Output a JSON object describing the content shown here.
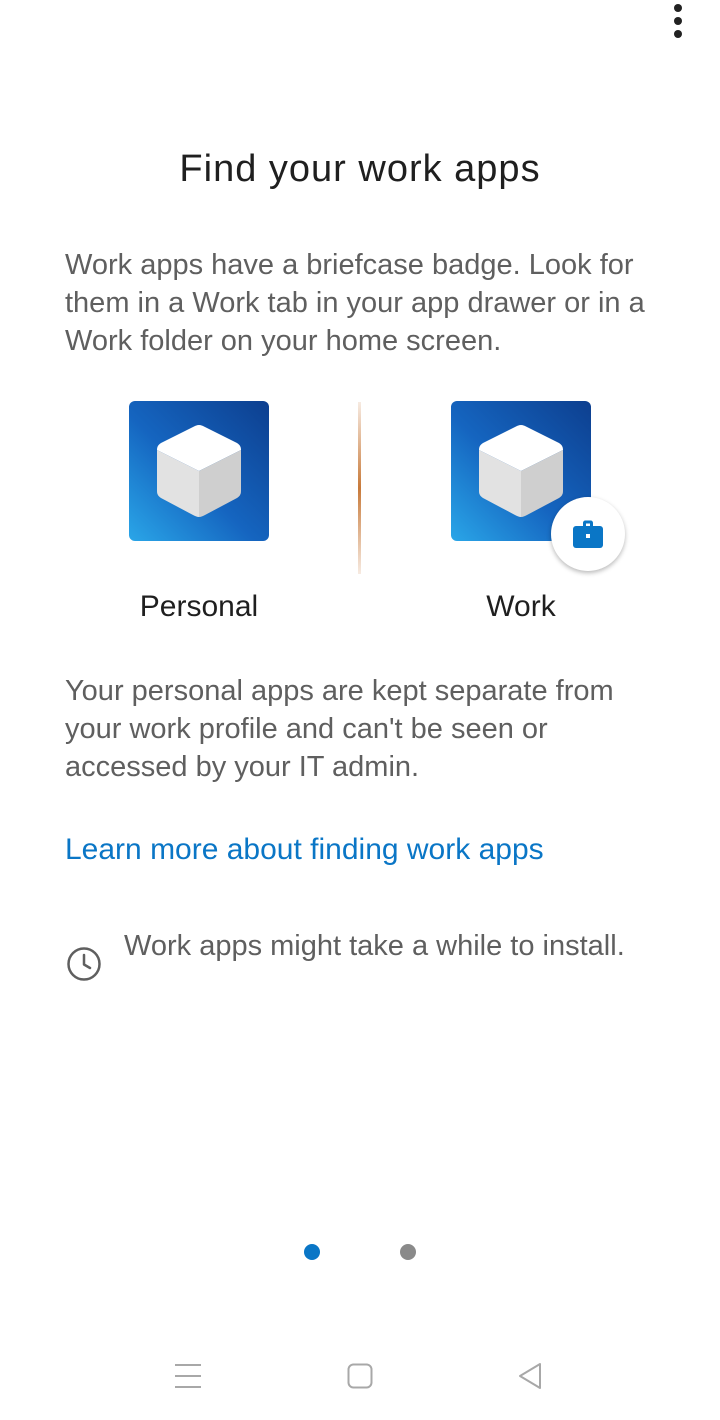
{
  "title": "Find your work apps",
  "intro": "Work apps have a briefcase badge. Look for them in a Work tab in your app drawer or in a Work folder on your home screen.",
  "apps": {
    "personal_label": "Personal",
    "work_label": "Work"
  },
  "separate_text": "Your personal apps are kept separate from your work profile and can't be seen or accessed by your IT admin.",
  "learn_more_link": "Learn more about finding work apps",
  "install_note": "Work apps might take a while to install.",
  "pager": {
    "total_pages": 2,
    "current_page": 1,
    "active_color": "#0a76c6",
    "inactive_color": "#8a8a8a"
  },
  "icons": {
    "overflow": "more-vert-icon",
    "cube": "cube-app-icon",
    "briefcase": "briefcase-icon",
    "clock": "clock-icon",
    "nav_menu": "menu-icon",
    "nav_home": "home-square-icon",
    "nav_back": "back-triangle-icon"
  },
  "colors": {
    "accent": "#0a76c6",
    "title_text": "#1f1f1f",
    "body_text": "#5f5f5f"
  }
}
